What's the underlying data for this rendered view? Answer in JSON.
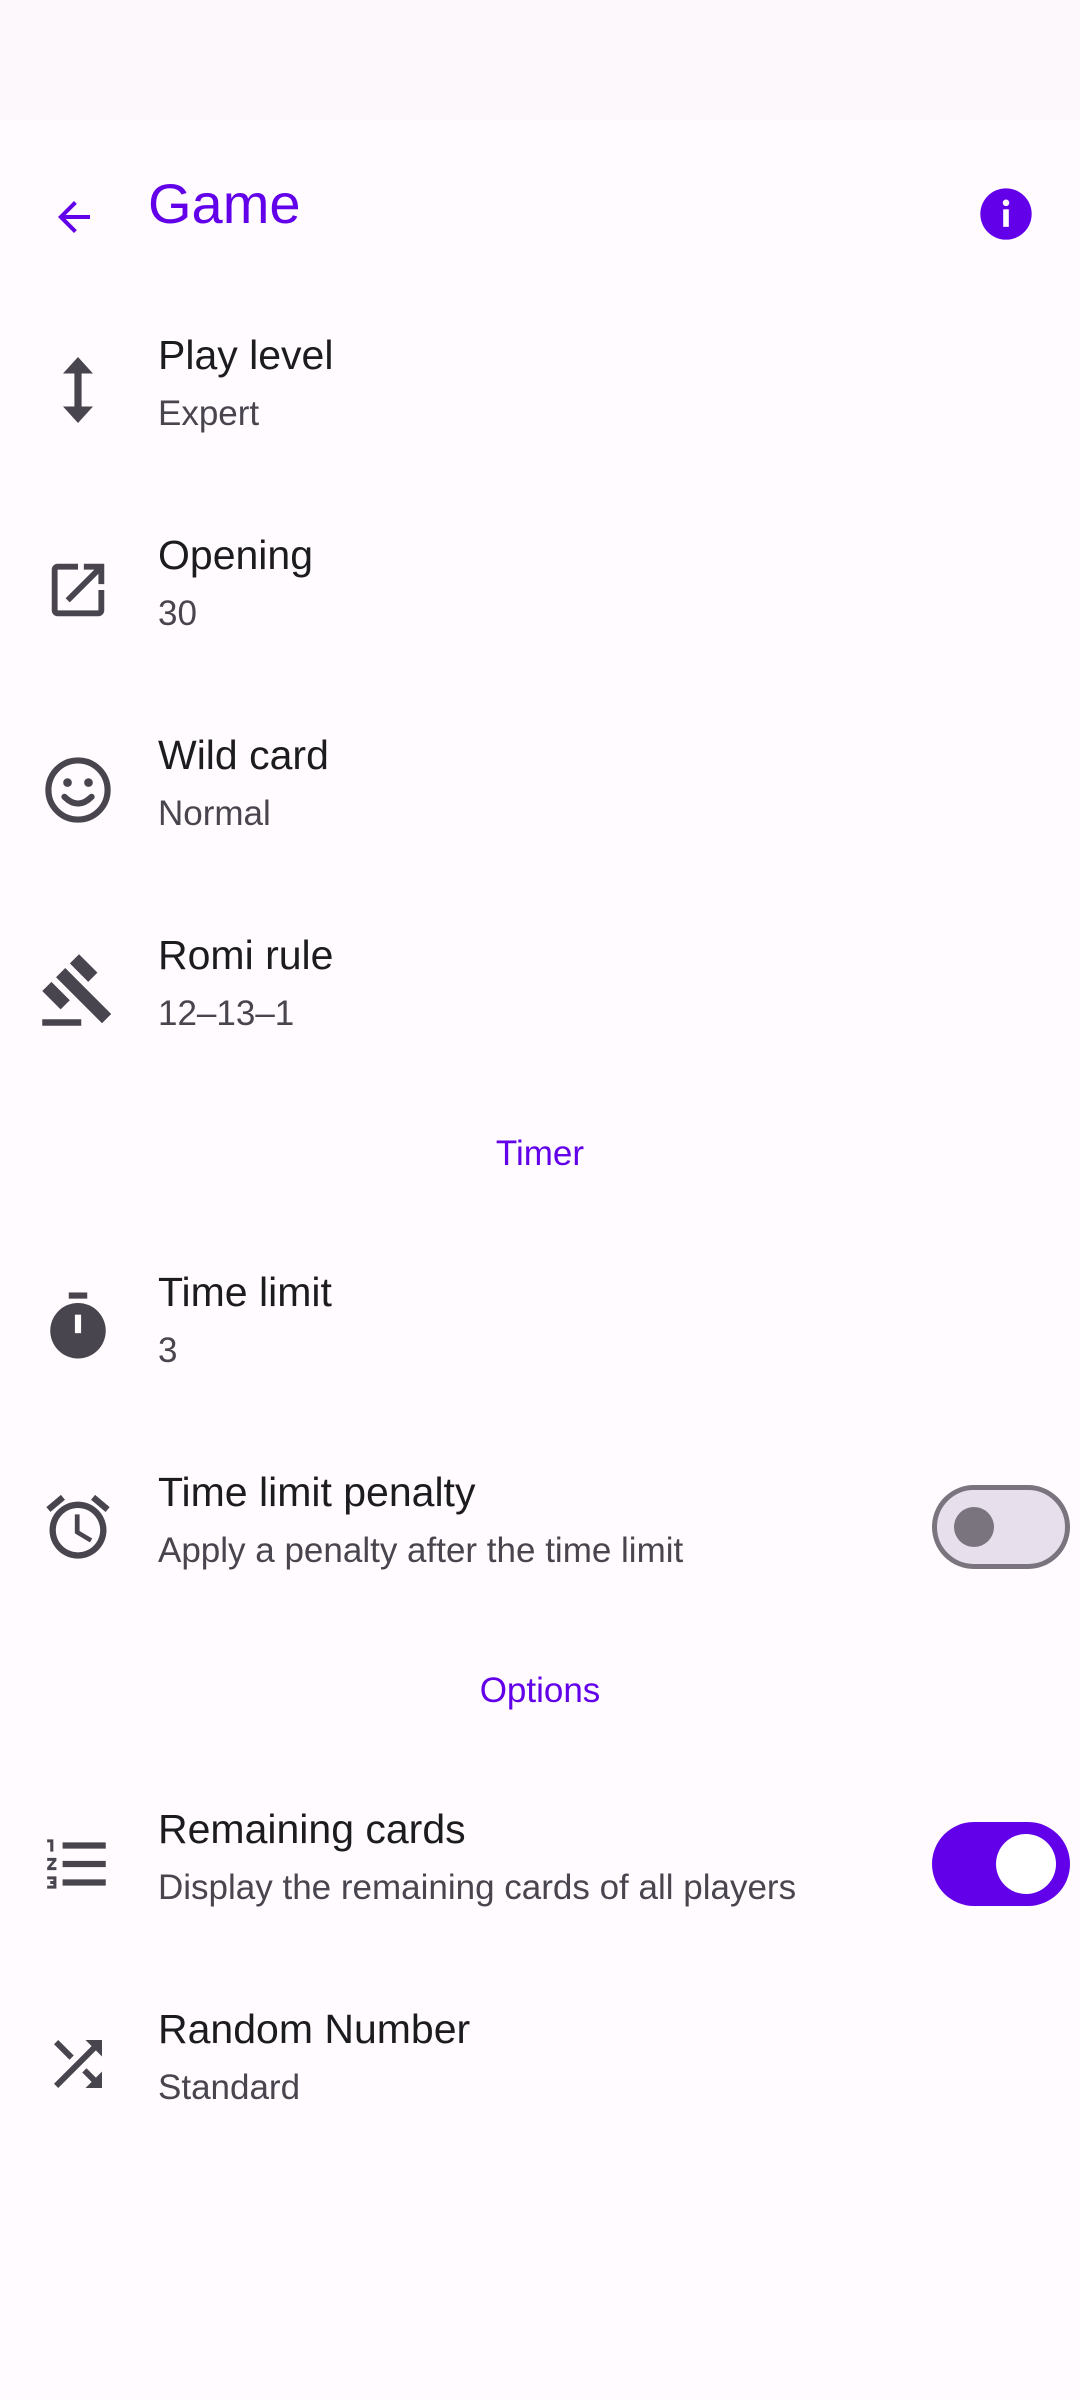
{
  "appbar": {
    "title": "Game",
    "back_icon": "arrow-back-icon",
    "info_icon": "info-icon"
  },
  "colors": {
    "accent": "#6200ea",
    "icon": "#49454f",
    "background": "#fffbfe"
  },
  "rows": [
    {
      "title": "Play level",
      "summary": "Expert",
      "icon": "swap-vertical-icon"
    },
    {
      "title": "Opening",
      "summary": "30",
      "icon": "open-in-new-icon"
    },
    {
      "title": "Wild card",
      "summary": "Normal",
      "icon": "smiley-face-icon"
    },
    {
      "title": "Romi rule",
      "summary": "12–13–1",
      "icon": "gavel-icon"
    }
  ],
  "sections": {
    "timer": "Timer",
    "options": "Options"
  },
  "timer_rows": [
    {
      "title": "Time limit",
      "summary": "3",
      "icon": "timer-icon"
    },
    {
      "title": "Time limit penalty",
      "summary": "Apply a penalty after the time limit",
      "icon": "alarm-icon",
      "switch": false
    }
  ],
  "option_rows": [
    {
      "title": "Remaining cards",
      "summary": "Display the remaining cards of all players",
      "icon": "numbered-list-icon",
      "switch": true
    },
    {
      "title": "Random Number",
      "summary": "Standard",
      "icon": "shuffle-icon"
    }
  ]
}
